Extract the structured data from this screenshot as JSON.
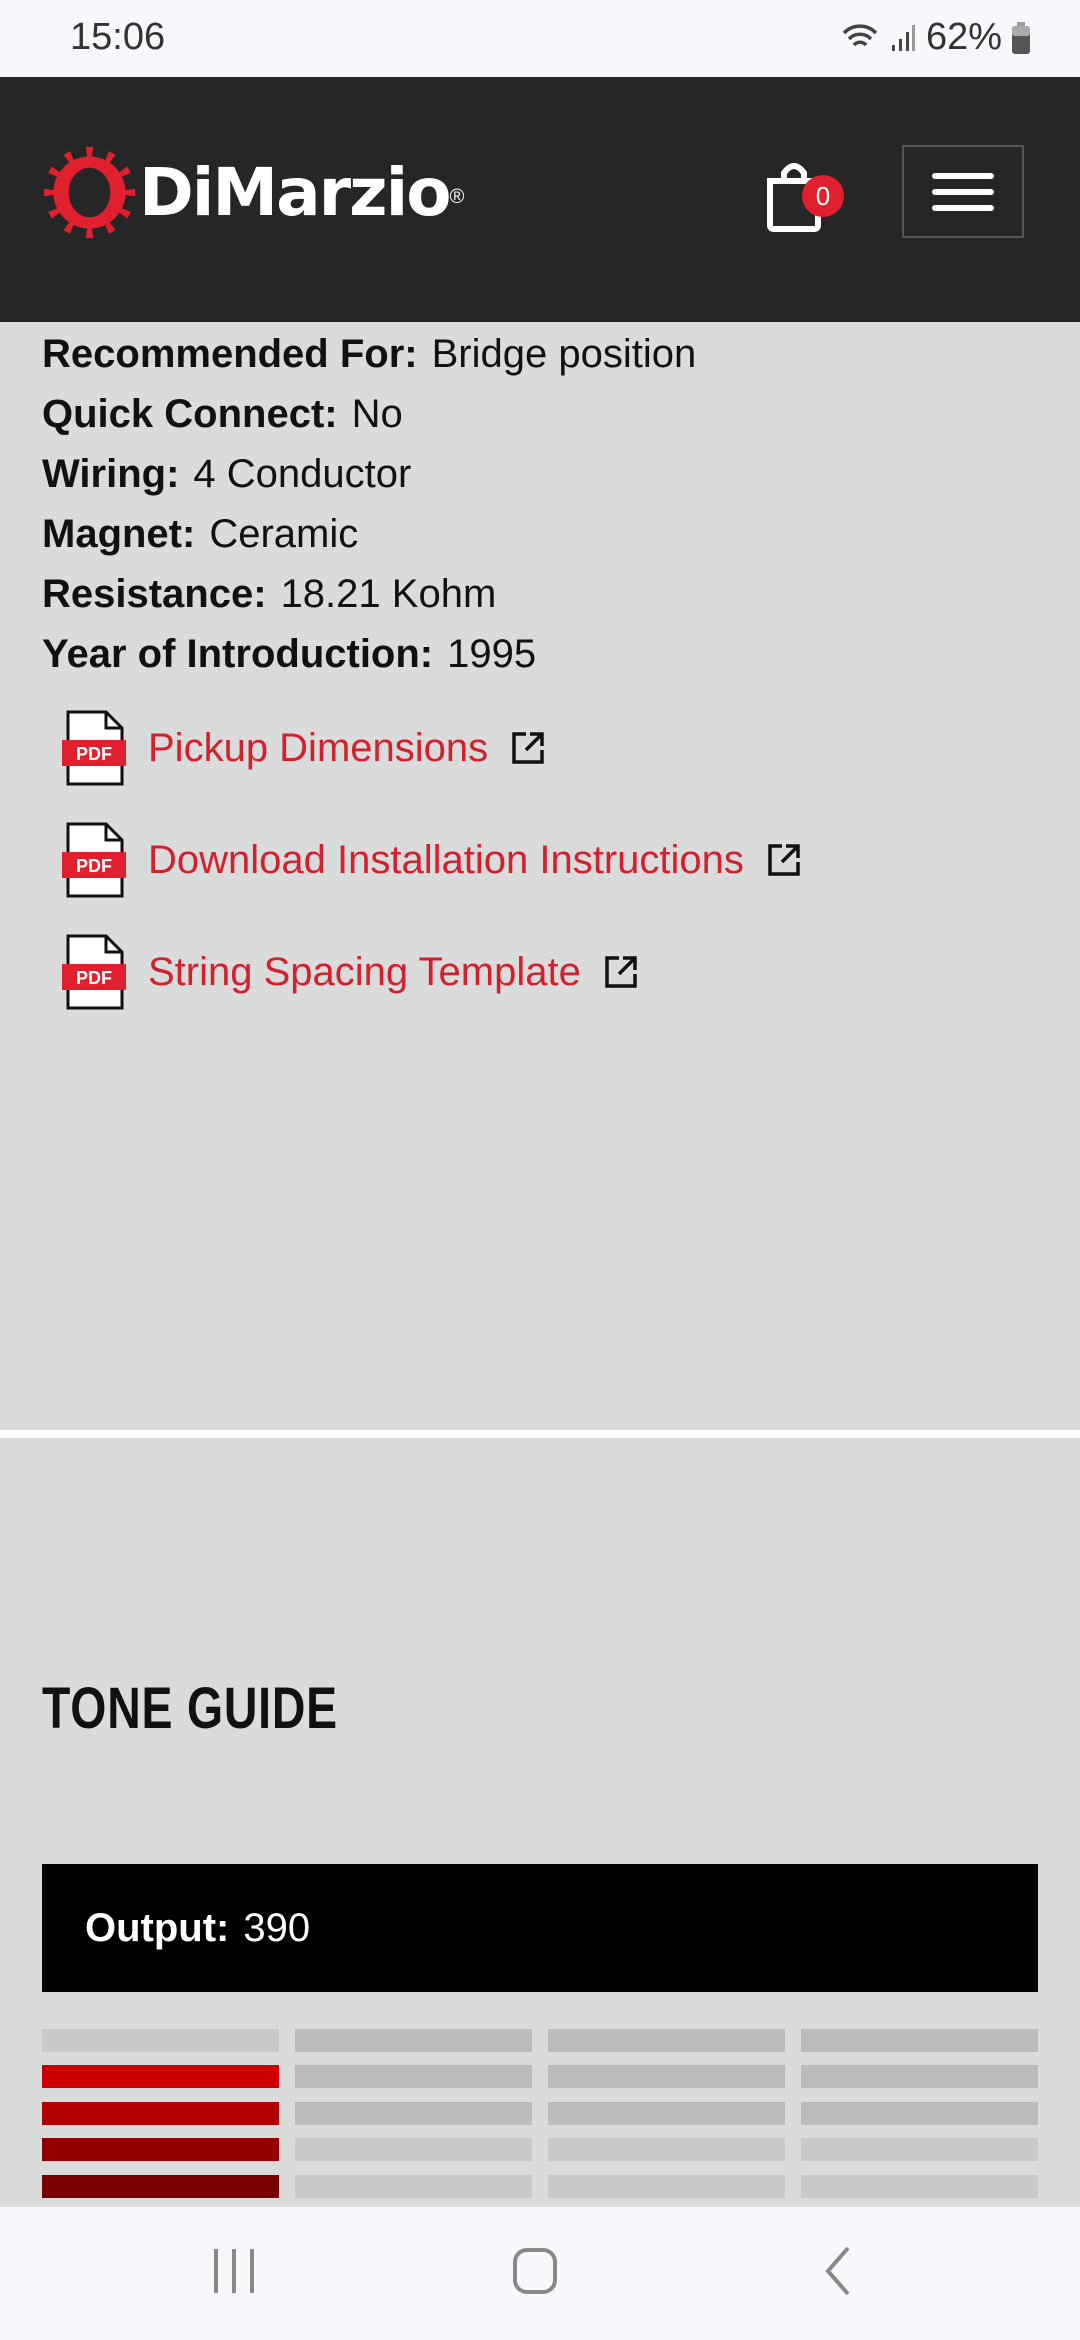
{
  "status_bar": {
    "time": "15:06",
    "battery": "62%"
  },
  "header": {
    "brand": "DiMarzio",
    "registered": "®",
    "cart_count": "0",
    "colors": {
      "brand_red": "#e0202e",
      "header_bg": "#262626"
    }
  },
  "specs": [
    {
      "label": "Recommended For:",
      "value": "Bridge position"
    },
    {
      "label": "Quick Connect:",
      "value": "No"
    },
    {
      "label": "Wiring:",
      "value": "4 Conductor"
    },
    {
      "label": "Magnet:",
      "value": "Ceramic"
    },
    {
      "label": "Resistance:",
      "value": "18.21 Kohm"
    },
    {
      "label": "Year of Introduction:",
      "value": "1995"
    }
  ],
  "downloads": [
    {
      "label": "Pickup Dimensions",
      "icon": "pdf-icon"
    },
    {
      "label": "Download Installation Instructions",
      "icon": "pdf-icon"
    },
    {
      "label": "String Spacing Template",
      "icon": "pdf-icon"
    }
  ],
  "pdf_badge": "PDF",
  "tone_guide": {
    "title": "TONE GUIDE",
    "output_label": "Output:",
    "output_value": "390",
    "level_rows_lit_in_first_column": 4,
    "rows": [
      [
        "#c9c9c9",
        "#bbbbbb",
        "#bbbbbb",
        "#bbbbbb"
      ],
      [
        "#cc0000",
        "#bbbbbb",
        "#bbbbbb",
        "#bbbbbb"
      ],
      [
        "#b00000",
        "#bbbbbb",
        "#bbbbbb",
        "#bbbbbb"
      ],
      [
        "#930000",
        "#c9c9c9",
        "#c9c9c9",
        "#c9c9c9"
      ],
      [
        "#780000",
        "#c9c9c9",
        "#c9c9c9",
        "#c9c9c9"
      ]
    ]
  }
}
